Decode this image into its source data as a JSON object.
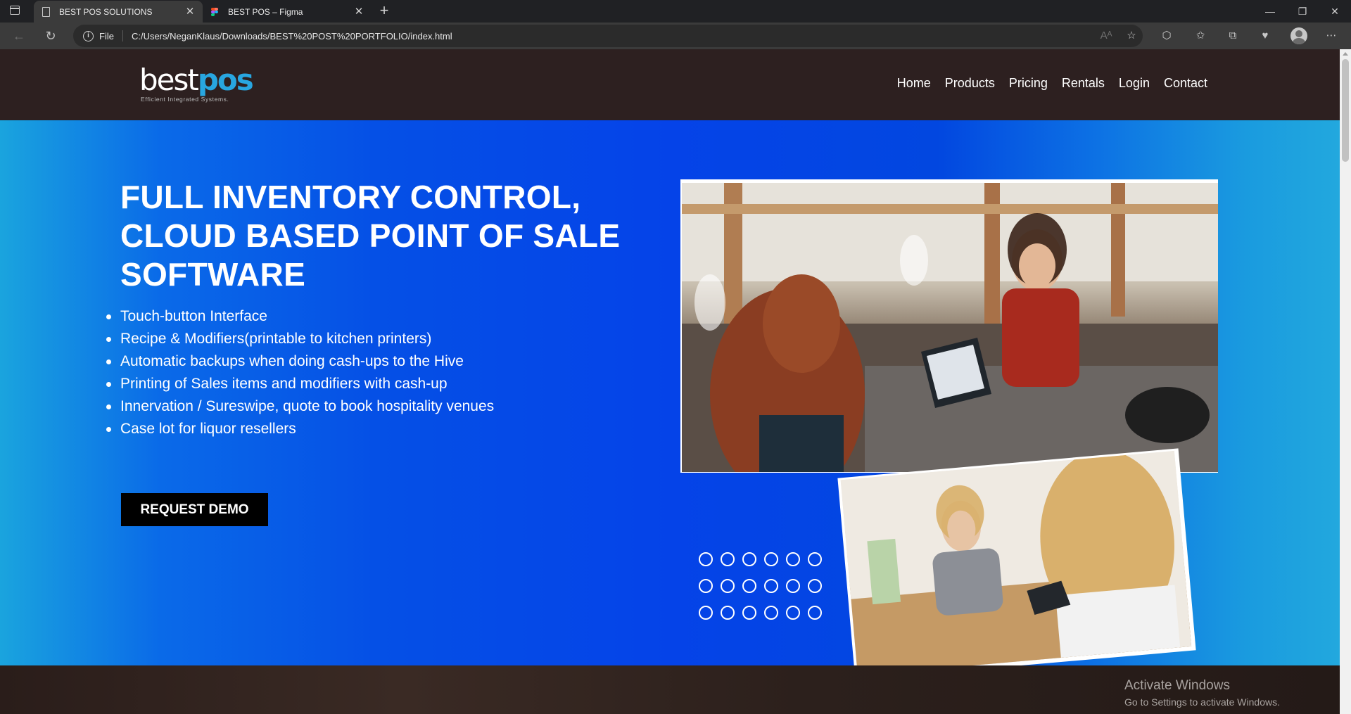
{
  "browser": {
    "tabs": [
      {
        "title": "BEST POS SOLUTIONS",
        "active": true,
        "icon": "document-icon"
      },
      {
        "title": "BEST POS – Figma",
        "active": false,
        "icon": "figma-icon"
      }
    ],
    "address": {
      "scheme_label": "File",
      "url": "C:/Users/NeganKlaus/Downloads/BEST%20POST%20PORTFOLIO/index.html"
    }
  },
  "site": {
    "logo": {
      "best": "best",
      "pos": "pos",
      "tagline": "Efficient Integrated Systems."
    },
    "nav": [
      "Home",
      "Products",
      "Pricing",
      "Rentals",
      "Login",
      "Contact"
    ],
    "hero": {
      "heading": "FULL INVENTORY CONTROL, CLOUD BASED POINT OF SALE SOFTWARE",
      "features": [
        "Touch-button Interface",
        "Recipe & Modifiers(printable to kitchen printers)",
        "Automatic backups when doing cash-ups to the Hive",
        "Printing of Sales items and modifiers with cash-up",
        "Innervation / Sureswipe, quote to book hospitality venues",
        "Case lot for liquor resellers"
      ],
      "cta": "REQUEST DEMO"
    }
  },
  "overlay": {
    "title": "Activate Windows",
    "subtitle": "Go to Settings to activate Windows."
  },
  "colors": {
    "header_bg": "#2d2020",
    "hero_blue": "#0543e8",
    "accent": "#28a6e0",
    "cta_bg": "#000000"
  }
}
